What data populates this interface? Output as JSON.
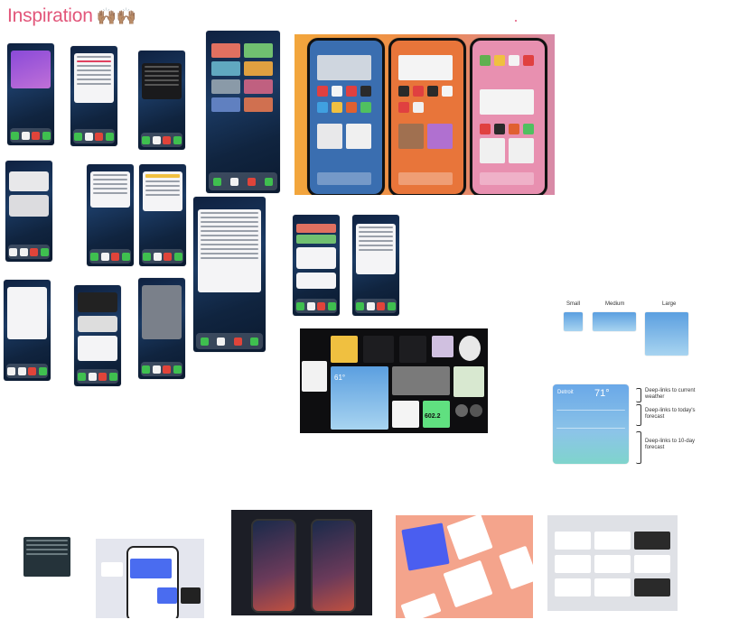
{
  "page": {
    "title": "Inspiration",
    "title_emoji": "🙌🏽🙌🏽"
  },
  "weather_sizes": {
    "small": "Small",
    "medium": "Medium",
    "large": "Large"
  },
  "weather_large": {
    "city": "Detroit",
    "temp": "71°"
  },
  "annotations": [
    "Deep-links to current weather",
    "Deep-links to today's forecast",
    "Deep-links to 10-day forecast"
  ],
  "dark_collage": {
    "temp": "61°",
    "count": "602.2"
  },
  "colors": {
    "title": "#e2567a",
    "phone_bg": "#15305a",
    "orange_bg": "#f0a040",
    "weather_blue": "#6aa8e8",
    "peach_bg": "#f4a48c"
  }
}
